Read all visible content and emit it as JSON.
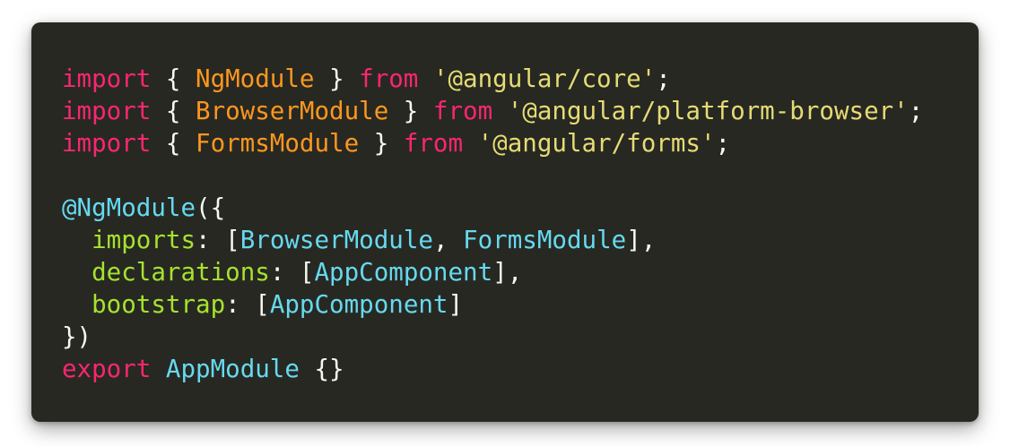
{
  "colors": {
    "background": "#272822",
    "keyword": "#f92672",
    "import_name": "#fd971f",
    "string": "#e6db74",
    "property": "#a6e22e",
    "identifier": "#66d9ef",
    "punctuation": "#f8f8f2"
  },
  "code": {
    "lines": [
      {
        "tokens": [
          {
            "t": "import",
            "c": "keyword"
          },
          {
            "t": " { ",
            "c": "punctuation"
          },
          {
            "t": "NgModule",
            "c": "import_name"
          },
          {
            "t": " } ",
            "c": "punctuation"
          },
          {
            "t": "from",
            "c": "keyword"
          },
          {
            "t": " ",
            "c": "punctuation"
          },
          {
            "t": "'@angular/core'",
            "c": "string"
          },
          {
            "t": ";",
            "c": "punctuation"
          }
        ]
      },
      {
        "tokens": [
          {
            "t": "import",
            "c": "keyword"
          },
          {
            "t": " { ",
            "c": "punctuation"
          },
          {
            "t": "BrowserModule",
            "c": "import_name"
          },
          {
            "t": " } ",
            "c": "punctuation"
          },
          {
            "t": "from",
            "c": "keyword"
          },
          {
            "t": " ",
            "c": "punctuation"
          },
          {
            "t": "'@angular/platform-browser'",
            "c": "string"
          },
          {
            "t": ";",
            "c": "punctuation"
          }
        ]
      },
      {
        "tokens": [
          {
            "t": "import",
            "c": "keyword"
          },
          {
            "t": " { ",
            "c": "punctuation"
          },
          {
            "t": "FormsModule",
            "c": "import_name"
          },
          {
            "t": " } ",
            "c": "punctuation"
          },
          {
            "t": "from",
            "c": "keyword"
          },
          {
            "t": " ",
            "c": "punctuation"
          },
          {
            "t": "'@angular/forms'",
            "c": "string"
          },
          {
            "t": ";",
            "c": "punctuation"
          }
        ]
      },
      {
        "tokens": []
      },
      {
        "tokens": [
          {
            "t": "@NgModule",
            "c": "identifier"
          },
          {
            "t": "({",
            "c": "punctuation"
          }
        ]
      },
      {
        "tokens": [
          {
            "t": "  ",
            "c": "punctuation"
          },
          {
            "t": "imports",
            "c": "property"
          },
          {
            "t": ": [",
            "c": "punctuation"
          },
          {
            "t": "BrowserModule",
            "c": "identifier"
          },
          {
            "t": ", ",
            "c": "punctuation"
          },
          {
            "t": "FormsModule",
            "c": "identifier"
          },
          {
            "t": "],",
            "c": "punctuation"
          }
        ]
      },
      {
        "tokens": [
          {
            "t": "  ",
            "c": "punctuation"
          },
          {
            "t": "declarations",
            "c": "property"
          },
          {
            "t": ": [",
            "c": "punctuation"
          },
          {
            "t": "AppComponent",
            "c": "identifier"
          },
          {
            "t": "],",
            "c": "punctuation"
          }
        ]
      },
      {
        "tokens": [
          {
            "t": "  ",
            "c": "punctuation"
          },
          {
            "t": "bootstrap",
            "c": "property"
          },
          {
            "t": ": [",
            "c": "punctuation"
          },
          {
            "t": "AppComponent",
            "c": "identifier"
          },
          {
            "t": "]",
            "c": "punctuation"
          }
        ]
      },
      {
        "tokens": [
          {
            "t": "})",
            "c": "punctuation"
          }
        ]
      },
      {
        "tokens": [
          {
            "t": "export",
            "c": "keyword"
          },
          {
            "t": " ",
            "c": "punctuation"
          },
          {
            "t": "AppModule",
            "c": "identifier"
          },
          {
            "t": " {}",
            "c": "punctuation"
          }
        ]
      }
    ]
  }
}
